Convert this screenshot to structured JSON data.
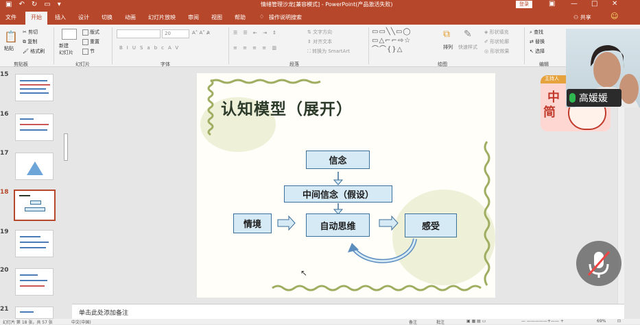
{
  "window": {
    "title": "情绪管理沙龙[兼容模式] - PowerPoint(产品激活失败)",
    "login_label": "登录",
    "share_label": "共享"
  },
  "tabs": [
    "文件",
    "开始",
    "插入",
    "设计",
    "切换",
    "动画",
    "幻灯片放映",
    "审阅",
    "视图",
    "帮助",
    "操作说明搜索"
  ],
  "active_tab": "开始",
  "ribbon": {
    "clipboard": {
      "paste": "粘贴",
      "cut": "剪切",
      "copy": "复制",
      "format_painter": "格式刷",
      "group": "剪贴板"
    },
    "slides": {
      "new_slide": "新建\n幻灯片",
      "layout": "版式",
      "reset": "重置",
      "section": "节",
      "group": "幻灯片"
    },
    "font": {
      "size": "20",
      "group": "字体"
    },
    "paragraph": {
      "text_direction": "文字方向",
      "align_text": "对齐文本",
      "smartart": "转换为 SmartArt",
      "group": "段落"
    },
    "drawing": {
      "arrange": "排列",
      "quick_styles": "快速样式",
      "shape_fill": "形状填充",
      "shape_outline": "形状轮廓",
      "shape_effects": "形状效果",
      "group": "绘图"
    },
    "editing": {
      "find": "查找",
      "replace": "替换",
      "select": "选择",
      "group": "编辑"
    }
  },
  "thumbnails": [
    {
      "num": "15"
    },
    {
      "num": "16"
    },
    {
      "num": "17"
    },
    {
      "num": "18",
      "current": true
    },
    {
      "num": "19"
    },
    {
      "num": "20"
    },
    {
      "num": "21"
    }
  ],
  "slide": {
    "title": "认知模型（展开）",
    "nodes": {
      "belief": "信念",
      "intermediate": "中间信念（假设）",
      "situation": "情境",
      "auto_thought": "自动思维",
      "feeling": "感受"
    }
  },
  "notes_placeholder": "单击此处添加备注",
  "status": {
    "slide_info": "幻灯片 第 18 张，共 57 张",
    "language": "中文(中国)",
    "notes": "备注",
    "comments": "批注",
    "zoom": "69%"
  },
  "overlay": {
    "presenter_name": "高媛媛",
    "logo_text_1": "中",
    "logo_text_2": "简",
    "logo_badge": "主持人"
  },
  "colors": {
    "accent": "#b7472a",
    "node_fill": "#d6eaf6",
    "node_border": "#3b6e99"
  }
}
